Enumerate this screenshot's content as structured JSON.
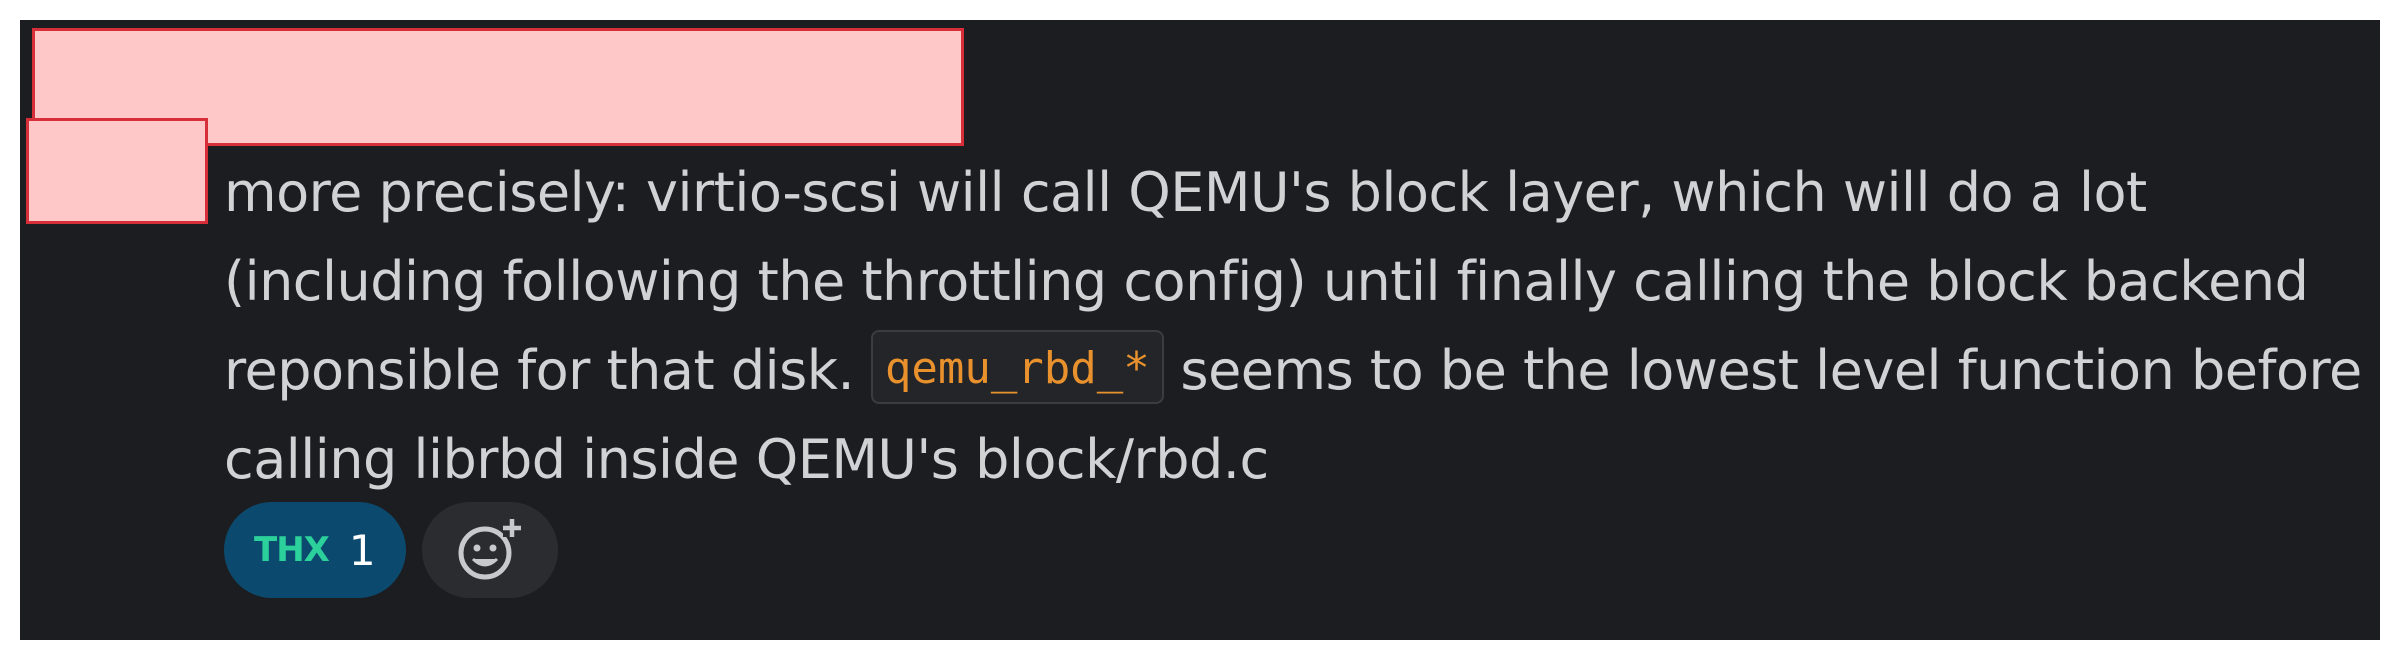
{
  "message": {
    "lines": [
      "more precisely: virtio-scsi will call QEMU's block layer, which will do a lot",
      "(including following the throttling config) until finally calling the block backend",
      "reponsible for that disk."
    ],
    "code": "qemu_rbd_*",
    "line3_after": " seems to be the lowest level function before",
    "line4": "calling librbd inside QEMU's block/rbd.c"
  },
  "reactions": [
    {
      "emoji_text": "THX",
      "count": "1"
    }
  ],
  "add_reaction_icon": "add-emoji-icon",
  "colors": {
    "background": "#1c1d21",
    "text": "#d1d2d3",
    "code": "#e8912d",
    "reaction_bg": "#0b4a6e",
    "thx": "#2bd09a",
    "redaction": "#ffc8c8"
  }
}
